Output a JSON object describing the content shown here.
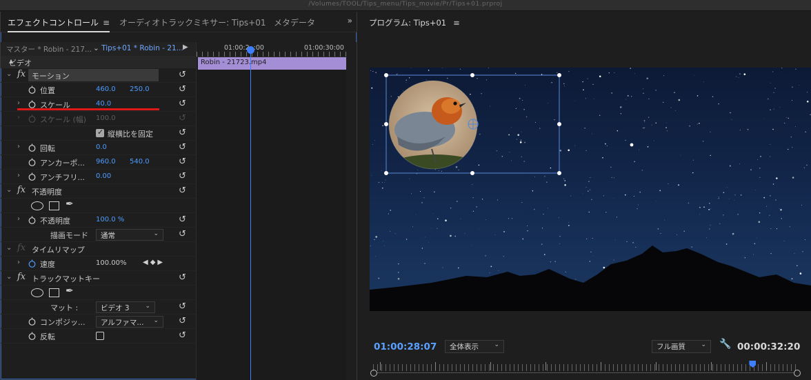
{
  "window": {
    "title": "/Volumes/TOOL/Tips_menu/Tips_movie/Pr/Tips+01.prproj"
  },
  "left_panel": {
    "tabs": [
      {
        "label": "エフェクトコントロール",
        "active": true
      },
      {
        "label": "オーディオトラックミキサー: Tips+01",
        "active": false
      },
      {
        "label": "メタデータ",
        "active": false
      }
    ],
    "menu_icon": "hamburger-icon",
    "more_icon": "double-chevron-right-icon",
    "master_label": "マスター * Robin - 217...",
    "sequence_label": "Tips+01 * Robin - 21...",
    "section_video": "ビデオ",
    "effects": {
      "motion": {
        "name": "モーション",
        "position": {
          "label": "位置",
          "x": "460.0",
          "y": "250.0"
        },
        "scale": {
          "label": "スケール",
          "value": "40.0"
        },
        "scale_width": {
          "label": "スケール (幅)",
          "value": "100.0"
        },
        "uniform_scale": {
          "label": "縦横比を固定",
          "checked": true
        },
        "rotation": {
          "label": "回転",
          "value": "0.0"
        },
        "anchor": {
          "label": "アンカーポ...",
          "x": "960.0",
          "y": "540.0"
        },
        "anti_flicker": {
          "label": "アンチフリ...",
          "value": "0.00"
        }
      },
      "opacity": {
        "name": "不透明度",
        "opacity": {
          "label": "不透明度",
          "value": "100.0 %"
        },
        "blend_mode": {
          "label": "描画モード",
          "value": "通常"
        }
      },
      "time_remap": {
        "name": "タイムリマップ",
        "speed": {
          "label": "速度",
          "value": "100.00%"
        }
      },
      "track_matte": {
        "name": "トラックマットキー",
        "matte": {
          "label": "マット :",
          "value": "ビデオ 3"
        },
        "composite": {
          "label": "コンポジッ...",
          "value": "アルファマ..."
        },
        "reverse": {
          "label": "反転",
          "checked": false
        }
      }
    },
    "timeline": {
      "tc_left": "01:00:2",
      "tc_left_end": ":00",
      "tc_right": "01:00:30:00",
      "clip_name": "Robin - 21723.mp4"
    }
  },
  "program": {
    "title": "プログラム: Tips+01",
    "current_timecode": "01:00:28:07",
    "zoom": "全体表示",
    "quality": "フル画質",
    "duration": "00:00:32:20",
    "scrub_position": 0.895
  },
  "colors": {
    "accent_blue": "#4d9cff",
    "highlight_red": "#e01818",
    "clip_purple": "#a48ed6"
  }
}
